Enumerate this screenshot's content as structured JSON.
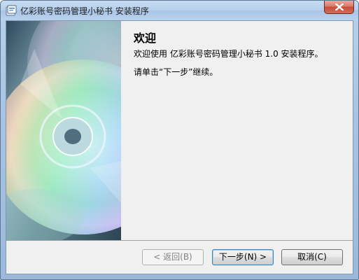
{
  "window": {
    "title": "亿彩账号密码管理小秘书 安装程序"
  },
  "content": {
    "heading": "欢迎",
    "welcome_line": "欢迎使用 亿彩账号密码管理小秘书 1.0 安装程序。",
    "instruction_line": "请单击“下一步”继续。"
  },
  "buttons": {
    "back": "< 返回(B)",
    "next": "下一步(N) >",
    "cancel": "取消(C)"
  },
  "icons": {
    "app": "installer-icon",
    "close": "close-icon",
    "side_image": "cd-disc-image"
  },
  "colors": {
    "title_bar": "#b9d1ea",
    "close_button": "#c74b3a",
    "panel_background": "#f0f0f0",
    "default_button_border": "#3c7fb1"
  }
}
